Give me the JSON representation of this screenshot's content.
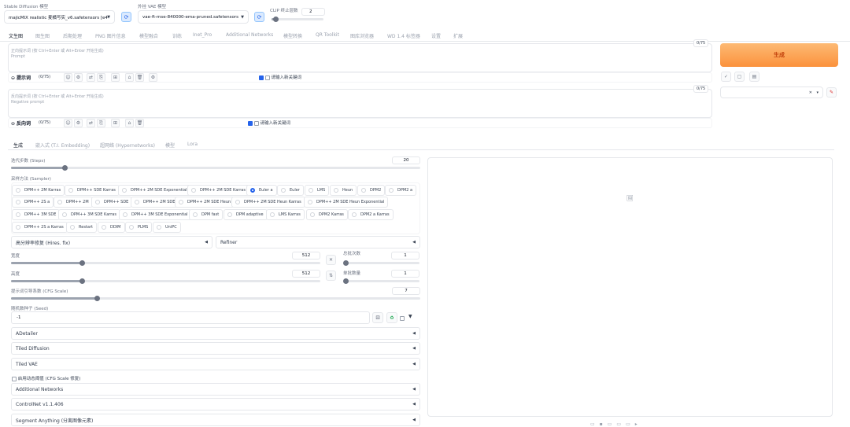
{
  "header": {
    "sd_model_label": "Stable Diffusion 模型",
    "sd_model_value": "majicMIX realistic 麦橘写实_v6.safetensors [e4",
    "vae_label": "外挂 VAE 模型",
    "vae_value": "vae-ft-mse-840000-ema-pruned.safetensors",
    "clip_label": "CLIP 终止层数",
    "clip_value": "2"
  },
  "main_tabs": [
    {
      "label": "文生图",
      "active": true
    },
    {
      "label": "图生图"
    },
    {
      "label": "后期处理"
    },
    {
      "label": "PNG 图片信息"
    },
    {
      "label": "模型融合"
    },
    {
      "label": "训练"
    },
    {
      "label": "Inet_Pro"
    },
    {
      "label": "Additional Networks"
    },
    {
      "label": "模型转换"
    },
    {
      "label": "QR Toolkit"
    },
    {
      "label": "图库浏览器"
    },
    {
      "label": "WD 1.4 标签器"
    },
    {
      "label": "设置"
    },
    {
      "label": "扩展"
    }
  ],
  "prompt": {
    "placeholder_line1": "正向提示词 (按 Ctrl+Enter 或 Alt+Enter 开始生成)",
    "placeholder_line2": "Prompt",
    "token_count": "0/75",
    "section_label": "提示词",
    "section_count": "(0/75)",
    "insert_label": "请输入新关键词"
  },
  "negative_prompt": {
    "placeholder_line1": "反向提示词 (按 Ctrl+Enter 或 Alt+Enter 开始生成)",
    "placeholder_line2": "Negative prompt",
    "token_count": "0/75",
    "section_label": "反向词",
    "section_count": "(0/75)",
    "insert_label": "请输入新关键词"
  },
  "generate_button": "生成",
  "sub_tabs": [
    {
      "label": "生成",
      "active": true
    },
    {
      "label": "嵌入式 (T.I. Embedding)"
    },
    {
      "label": "超网络 (Hypernetworks)"
    },
    {
      "label": "模型"
    },
    {
      "label": "Lora"
    }
  ],
  "steps": {
    "label": "迭代步数 (Steps)",
    "value": "20",
    "fraction": 0.13
  },
  "sampler": {
    "label": "采样方法 (Sampler)",
    "options": [
      {
        "label": "DPM++ 2M Karras"
      },
      {
        "label": "DPM++ SDE Karras"
      },
      {
        "label": "DPM++ 2M SDE Exponential"
      },
      {
        "label": "DPM++ 2M SDE Karras"
      },
      {
        "label": "Euler a",
        "selected": true
      },
      {
        "label": "Euler"
      },
      {
        "label": "LMS"
      },
      {
        "label": "Heun"
      },
      {
        "label": "DPM2"
      },
      {
        "label": "DPM2 a"
      },
      {
        "label": "DPM++ 2S a"
      },
      {
        "label": "DPM++ 2M"
      },
      {
        "label": "DPM++ SDE"
      },
      {
        "label": "DPM++ 2M SDE"
      },
      {
        "label": "DPM++ 2M SDE Heun"
      },
      {
        "label": "DPM++ 2M SDE Heun Karras"
      },
      {
        "label": "DPM++ 2M SDE Heun Exponential"
      },
      {
        "label": "DPM++ 3M SDE"
      },
      {
        "label": "DPM++ 3M SDE Karras"
      },
      {
        "label": "DPM++ 3M SDE Exponential"
      },
      {
        "label": "DPM fast"
      },
      {
        "label": "DPM adaptive"
      },
      {
        "label": "LMS Karras"
      },
      {
        "label": "DPM2 Karras"
      },
      {
        "label": "DPM2 a Karras"
      },
      {
        "label": "DPM++ 2S a Karras"
      },
      {
        "label": "Restart"
      },
      {
        "label": "DDIM"
      },
      {
        "label": "PLMS"
      },
      {
        "label": "UniPC"
      }
    ]
  },
  "hires_fix": {
    "label": "高分辨率修复 (Hires. fix)"
  },
  "refiner": {
    "label": "Refiner"
  },
  "width": {
    "label": "宽度",
    "value": "512",
    "fraction": 0.23
  },
  "height": {
    "label": "高度",
    "value": "512",
    "fraction": 0.23
  },
  "batch_count": {
    "label": "总批次数",
    "value": "1",
    "fraction": 0.0
  },
  "batch_size": {
    "label": "单批数量",
    "value": "1",
    "fraction": 0.0
  },
  "cfg_scale": {
    "label": "提示词引导系数 (CFG Scale)",
    "value": "7",
    "fraction": 0.21
  },
  "seed": {
    "label": "随机数种子 (Seed)",
    "value": "-1"
  },
  "accordions": {
    "adetailer": "ADetailer",
    "tiled_diffusion": "Tiled Diffusion",
    "tiled_vae": "Tiled VAE",
    "dynamic_threshold": "启用动态阈值 (CFG Scale 修复)",
    "additional_networks": "Additional Networks",
    "controlnet": "ControlNet v1.1.406",
    "segment_anything": "Segment Anything (分离图像元素)"
  },
  "icons": {
    "refresh": "refresh-icon",
    "dice": "dice-icon",
    "recycle": "recycle-icon",
    "image": "image-placeholder-icon",
    "pencil": "pencil-icon"
  },
  "colors": {
    "generate_start": "#fdba74",
    "generate_end": "#fb923c",
    "accent": "#2563eb",
    "generate_text": "#ea580c"
  }
}
